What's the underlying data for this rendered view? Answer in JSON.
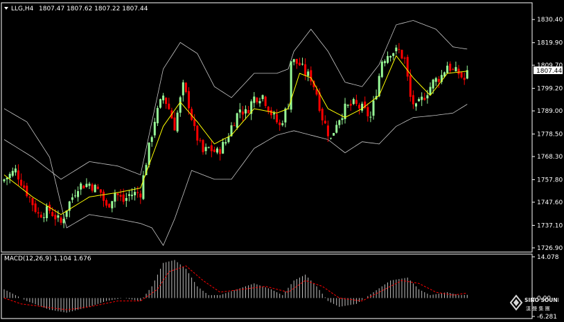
{
  "colors": {
    "background": "#000000",
    "bull": "#98FB98",
    "bear": "#FF0000",
    "ma": "#FFFF00",
    "band": "#C8C8C8",
    "macd_hist": "#C0C0C0",
    "signal": "#FF0000",
    "frame": "#FFFFFF",
    "text": "#FFFFFF"
  },
  "header": {
    "symbol_timeframe": "LLG,H4",
    "ohlc": "1807.47 1807.62 1807.22 1807.44"
  },
  "price_panel": {
    "y_ticks": [
      "1830.40",
      "1819.90",
      "1809.70",
      "1799.20",
      "1789.00",
      "1778.50",
      "1768.30",
      "1757.80",
      "1747.60",
      "1737.10",
      "1726.90"
    ],
    "current_price": "1807.44"
  },
  "macd_panel": {
    "label": "MACD(12,26,9) 1.104 1.676",
    "y_ticks": [
      "14.078",
      "0.00",
      "-6.281"
    ]
  },
  "logo": {
    "text": "SINO SOUND",
    "subtitle": "漢 聲 集 團"
  },
  "icons": {
    "menu": "triangle-down-icon",
    "logo_mark": "diamond-logo-icon"
  },
  "chart_data": {
    "type": "candlestick",
    "instrument": "LLG",
    "timeframe": "H4",
    "ylim": [
      1725.0,
      1838.0
    ],
    "last": 1807.44,
    "close_anchors": [
      [
        0,
        1758
      ],
      [
        4,
        1762
      ],
      [
        8,
        1752
      ],
      [
        12,
        1742
      ],
      [
        16,
        1744
      ],
      [
        20,
        1738
      ],
      [
        22,
        1745
      ],
      [
        26,
        1755
      ],
      [
        30,
        1756
      ],
      [
        34,
        1752
      ],
      [
        36,
        1745
      ],
      [
        39,
        1752
      ],
      [
        42,
        1748
      ],
      [
        44,
        1751
      ],
      [
        48,
        1752
      ],
      [
        50,
        1766
      ],
      [
        53,
        1785
      ],
      [
        56,
        1796
      ],
      [
        58,
        1790
      ],
      [
        60,
        1782
      ],
      [
        63,
        1800
      ],
      [
        65,
        1792
      ],
      [
        67,
        1780
      ],
      [
        70,
        1770
      ],
      [
        72,
        1772
      ],
      [
        75,
        1770
      ],
      [
        78,
        1775
      ],
      [
        80,
        1782
      ],
      [
        83,
        1790
      ],
      [
        85,
        1788
      ],
      [
        88,
        1795
      ],
      [
        91,
        1796
      ],
      [
        94,
        1788
      ],
      [
        97,
        1782
      ],
      [
        100,
        1792
      ],
      [
        101,
        1812
      ],
      [
        104,
        1810
      ],
      [
        106,
        1806
      ],
      [
        108,
        1804
      ],
      [
        110,
        1797
      ],
      [
        112,
        1786
      ],
      [
        115,
        1776
      ],
      [
        117,
        1784
      ],
      [
        120,
        1790
      ],
      [
        123,
        1792
      ],
      [
        126,
        1790
      ],
      [
        129,
        1786
      ],
      [
        131,
        1798
      ],
      [
        133,
        1812
      ],
      [
        136,
        1816
      ],
      [
        139,
        1816
      ],
      [
        141,
        1812
      ],
      [
        143,
        1795
      ],
      [
        145,
        1790
      ],
      [
        148,
        1796
      ],
      [
        151,
        1802
      ],
      [
        154,
        1805
      ],
      [
        156,
        1810
      ],
      [
        158,
        1807
      ],
      [
        160,
        1806
      ],
      [
        162,
        1803
      ],
      [
        163,
        1807
      ]
    ],
    "ma_anchors": [
      [
        0,
        1760
      ],
      [
        10,
        1750
      ],
      [
        20,
        1742
      ],
      [
        30,
        1750
      ],
      [
        40,
        1752
      ],
      [
        48,
        1754
      ],
      [
        56,
        1782
      ],
      [
        62,
        1793
      ],
      [
        68,
        1784
      ],
      [
        74,
        1774
      ],
      [
        80,
        1778
      ],
      [
        88,
        1790
      ],
      [
        96,
        1788
      ],
      [
        100,
        1790
      ],
      [
        104,
        1806
      ],
      [
        108,
        1804
      ],
      [
        114,
        1790
      ],
      [
        120,
        1786
      ],
      [
        126,
        1790
      ],
      [
        132,
        1796
      ],
      [
        138,
        1814
      ],
      [
        144,
        1804
      ],
      [
        150,
        1796
      ],
      [
        156,
        1806
      ],
      [
        163,
        1807
      ]
    ],
    "band_upper_anchors": [
      [
        0,
        1776
      ],
      [
        10,
        1768
      ],
      [
        20,
        1758
      ],
      [
        30,
        1766
      ],
      [
        40,
        1764
      ],
      [
        48,
        1760
      ],
      [
        56,
        1808
      ],
      [
        62,
        1820
      ],
      [
        68,
        1815
      ],
      [
        74,
        1800
      ],
      [
        80,
        1795
      ],
      [
        88,
        1806
      ],
      [
        96,
        1806
      ],
      [
        100,
        1808
      ],
      [
        102,
        1816
      ],
      [
        108,
        1826
      ],
      [
        114,
        1816
      ],
      [
        120,
        1802
      ],
      [
        126,
        1800
      ],
      [
        132,
        1810
      ],
      [
        138,
        1828
      ],
      [
        144,
        1830
      ],
      [
        152,
        1826
      ],
      [
        158,
        1818
      ],
      [
        163,
        1817
      ]
    ],
    "band_lower_anchors": [
      [
        0,
        1790
      ],
      [
        8,
        1784
      ],
      [
        16,
        1768
      ],
      [
        22,
        1736
      ],
      [
        30,
        1742
      ],
      [
        40,
        1740
      ],
      [
        48,
        1738
      ],
      [
        52,
        1736
      ],
      [
        56,
        1728
      ],
      [
        60,
        1740
      ],
      [
        66,
        1762
      ],
      [
        74,
        1758
      ],
      [
        80,
        1758
      ],
      [
        88,
        1772
      ],
      [
        96,
        1778
      ],
      [
        102,
        1780
      ],
      [
        108,
        1778
      ],
      [
        114,
        1776
      ],
      [
        120,
        1770
      ],
      [
        126,
        1775
      ],
      [
        132,
        1774
      ],
      [
        138,
        1782
      ],
      [
        144,
        1786
      ],
      [
        152,
        1787
      ],
      [
        158,
        1788
      ],
      [
        163,
        1792
      ]
    ],
    "macd_anchors": [
      [
        0,
        3
      ],
      [
        8,
        -1
      ],
      [
        16,
        -4
      ],
      [
        22,
        -5
      ],
      [
        30,
        -3
      ],
      [
        36,
        -1
      ],
      [
        42,
        0
      ],
      [
        48,
        -1
      ],
      [
        52,
        4
      ],
      [
        56,
        12
      ],
      [
        60,
        13
      ],
      [
        64,
        10
      ],
      [
        68,
        4
      ],
      [
        72,
        1
      ],
      [
        76,
        1
      ],
      [
        82,
        3
      ],
      [
        88,
        5
      ],
      [
        94,
        3
      ],
      [
        98,
        1
      ],
      [
        102,
        6
      ],
      [
        106,
        8
      ],
      [
        110,
        4
      ],
      [
        114,
        -1
      ],
      [
        118,
        -3
      ],
      [
        124,
        -2
      ],
      [
        130,
        2
      ],
      [
        136,
        6
      ],
      [
        142,
        7
      ],
      [
        146,
        3
      ],
      [
        150,
        1
      ],
      [
        156,
        2
      ],
      [
        160,
        1
      ],
      [
        163,
        1.1
      ]
    ],
    "signal_anchors": [
      [
        0,
        0
      ],
      [
        6,
        -2
      ],
      [
        14,
        -3
      ],
      [
        22,
        -4
      ],
      [
        30,
        -3
      ],
      [
        40,
        -1
      ],
      [
        48,
        -1
      ],
      [
        54,
        3
      ],
      [
        58,
        9
      ],
      [
        64,
        11
      ],
      [
        70,
        6
      ],
      [
        76,
        2
      ],
      [
        84,
        3
      ],
      [
        92,
        4
      ],
      [
        100,
        2
      ],
      [
        106,
        6
      ],
      [
        112,
        4
      ],
      [
        118,
        0
      ],
      [
        126,
        -1
      ],
      [
        134,
        3
      ],
      [
        140,
        6
      ],
      [
        146,
        5
      ],
      [
        152,
        2
      ],
      [
        158,
        1
      ],
      [
        163,
        1.7
      ]
    ]
  }
}
